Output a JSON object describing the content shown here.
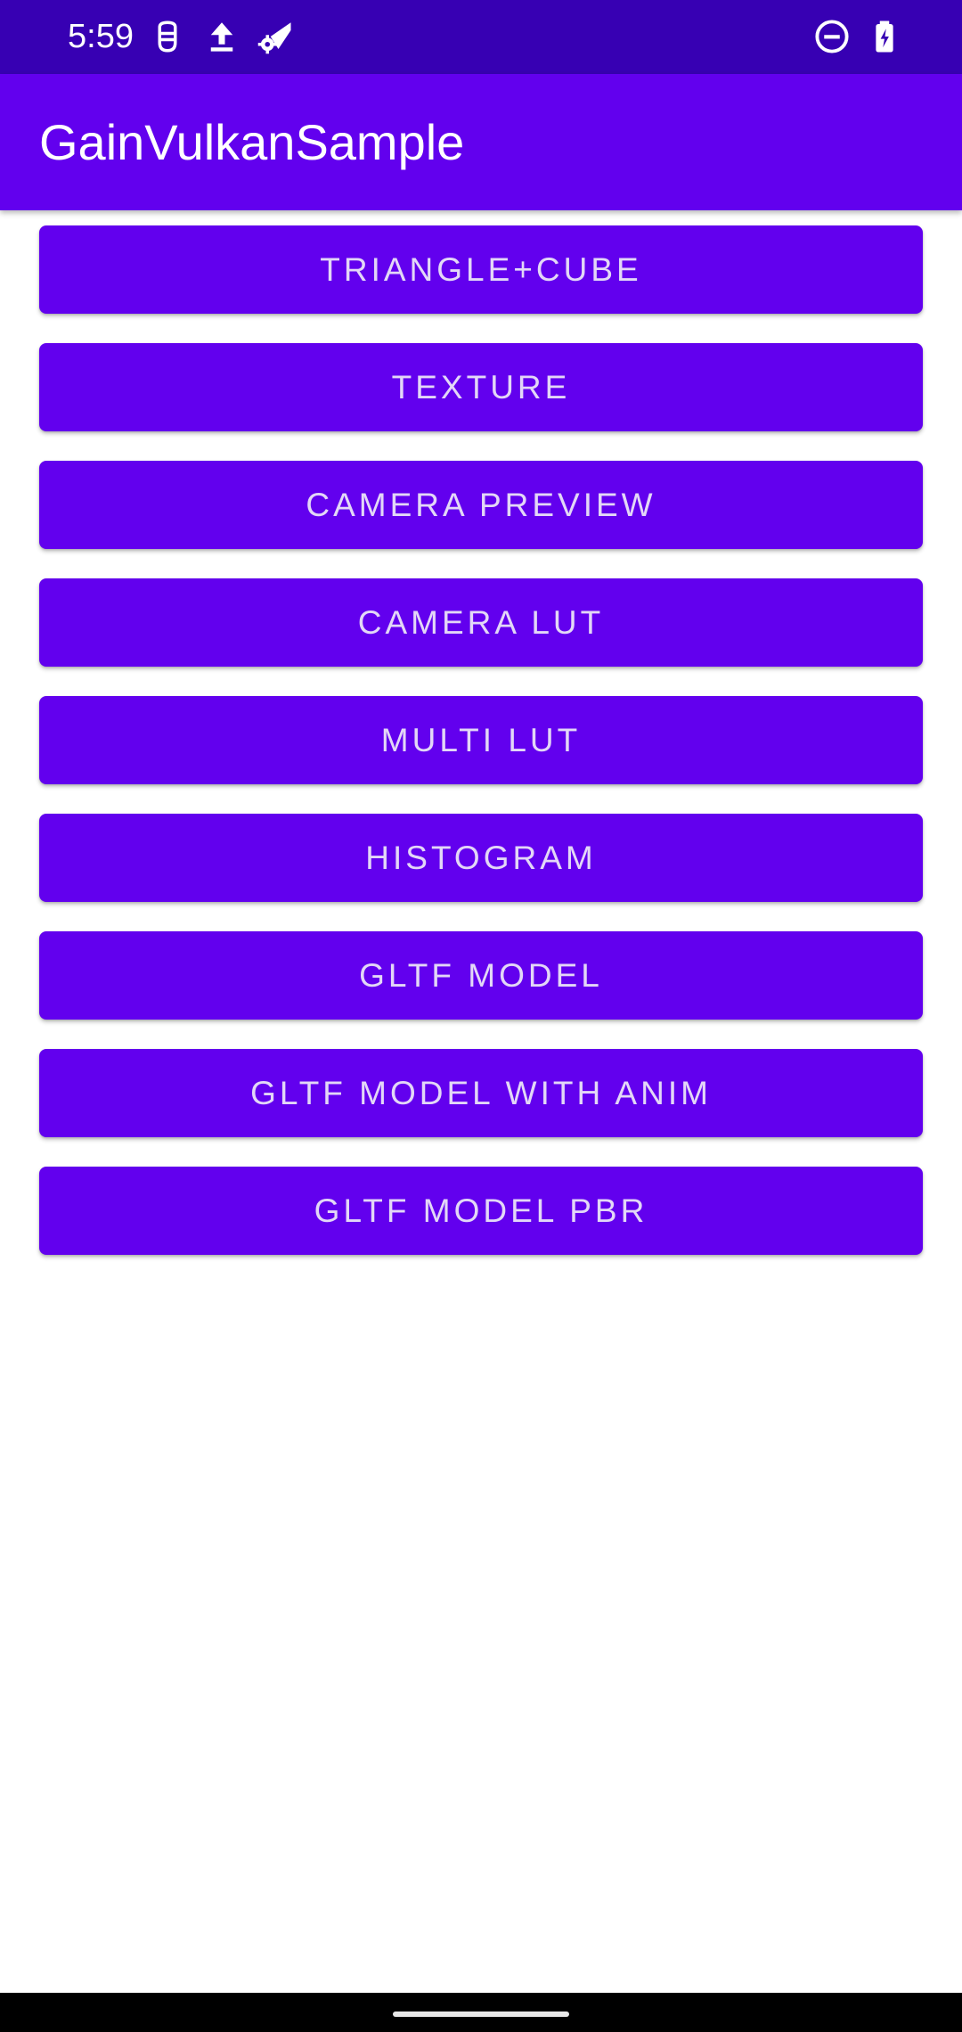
{
  "status_bar": {
    "time": "5:59",
    "icons_left": [
      "robot-face-icon",
      "upload-icon",
      "wifi-settings-icon"
    ],
    "icons_right": [
      "do-not-disturb-icon",
      "battery-charging-icon"
    ]
  },
  "app_bar": {
    "title": "GainVulkanSample"
  },
  "buttons": [
    {
      "label": "TRIANGLE+CUBE"
    },
    {
      "label": "TEXTURE"
    },
    {
      "label": "CAMERA PREVIEW"
    },
    {
      "label": "CAMERA LUT"
    },
    {
      "label": "MULTI LUT"
    },
    {
      "label": "HISTOGRAM"
    },
    {
      "label": "GLTF MODEL"
    },
    {
      "label": "GLTF MODEL WITH ANIM"
    },
    {
      "label": "GLTF MODEL PBR"
    }
  ],
  "colors": {
    "status_bar": "#3700b3",
    "primary": "#6200ee",
    "button_text": "#e3d7f7",
    "background": "#ffffff",
    "nav_bar": "#000000"
  }
}
